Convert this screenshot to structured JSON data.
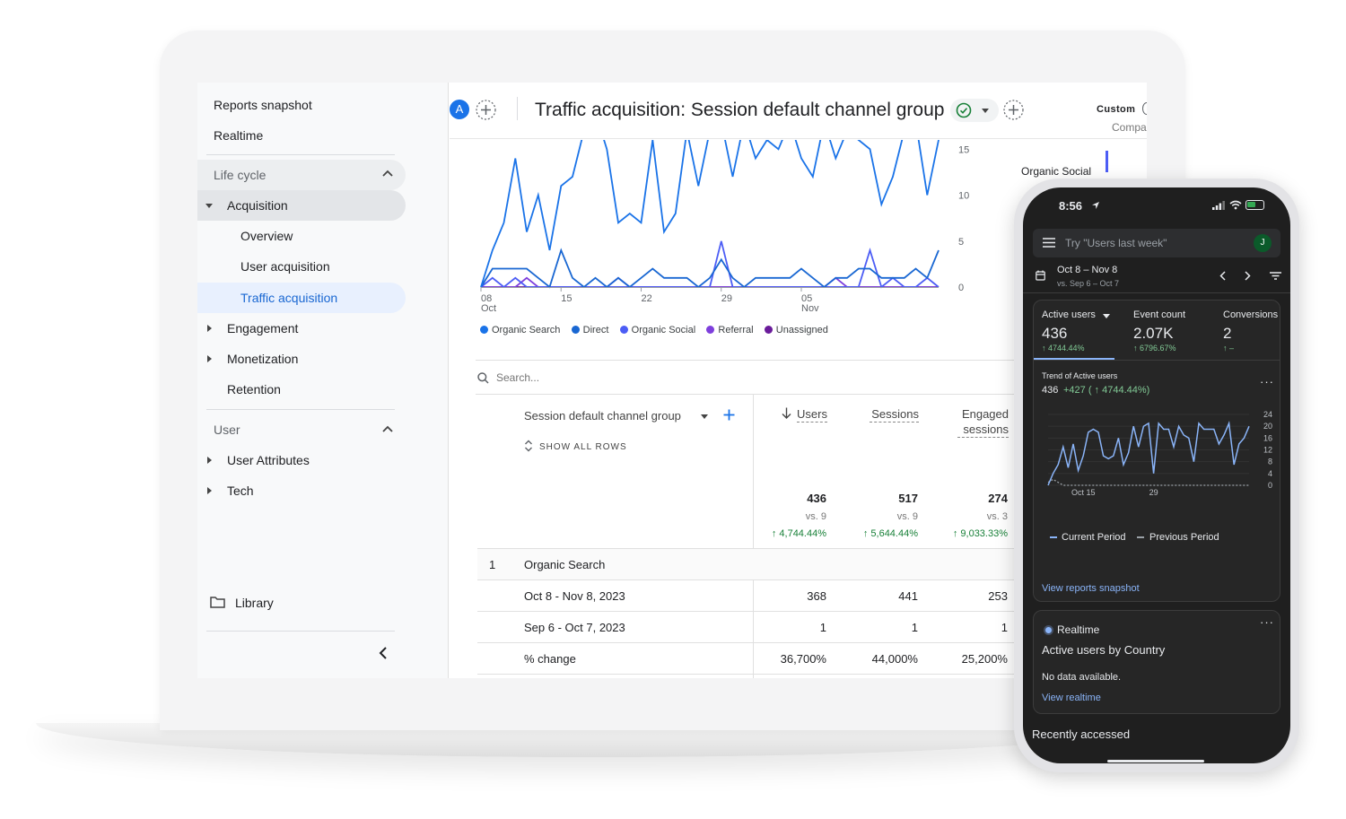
{
  "sidebar": {
    "top_items": [
      "Reports snapshot",
      "Realtime"
    ],
    "lifecycle": {
      "title": "Life cycle",
      "acquisition": {
        "label": "Acquisition",
        "children": [
          "Overview",
          "User acquisition",
          "Traffic acquisition"
        ]
      },
      "others": [
        "Engagement",
        "Monetization",
        "Retention"
      ]
    },
    "user": {
      "title": "User",
      "items": [
        "User Attributes",
        "Tech"
      ]
    },
    "library": "Library"
  },
  "header": {
    "avatar": "A",
    "title": "Traffic acquisition: Session default channel group",
    "custom": "Custom",
    "compare": "Compa"
  },
  "colors": {
    "organic_search": "#1a73e8",
    "direct": "#1967d2",
    "organic_social": "#4c5df5",
    "referral": "#7e3fdc",
    "unassigned": "#6a1b9a",
    "accent": "#1a73e8",
    "positive": "#188038"
  },
  "chart_data": {
    "type": "line",
    "x_tick_labels": [
      {
        "day": "08",
        "month": "Oct"
      },
      {
        "day": "15",
        "month": ""
      },
      {
        "day": "22",
        "month": ""
      },
      {
        "day": "29",
        "month": ""
      },
      {
        "day": "05",
        "month": "Nov"
      }
    ],
    "y_ticks": [
      0,
      5,
      10,
      15
    ],
    "ylim": [
      0,
      16
    ],
    "legend": [
      "Organic Search",
      "Direct",
      "Organic Social",
      "Referral",
      "Unassigned"
    ],
    "side_label": "Organic Social",
    "series": [
      {
        "name": "Organic Search",
        "values": [
          0,
          4,
          7,
          14,
          6,
          10,
          4,
          11,
          12,
          17,
          19,
          15,
          7,
          8,
          7,
          16,
          6,
          8,
          17,
          11,
          17,
          18,
          12,
          18,
          14,
          16,
          15,
          18,
          14,
          12,
          18,
          14,
          17,
          16,
          15,
          9,
          12,
          17,
          18,
          10,
          16
        ]
      },
      {
        "name": "Direct",
        "values": [
          0,
          2,
          2,
          2,
          2,
          1,
          0,
          4,
          1,
          0,
          1,
          0,
          1,
          0,
          1,
          2,
          1,
          1,
          1,
          0,
          1,
          3,
          1,
          0,
          1,
          1,
          1,
          1,
          2,
          1,
          0,
          1,
          1,
          2,
          2,
          1,
          1,
          1,
          2,
          1,
          4
        ]
      },
      {
        "name": "Organic Social",
        "values": [
          0,
          1,
          0,
          1,
          0,
          0,
          0,
          0,
          0,
          0,
          0,
          0,
          0,
          0,
          0,
          0,
          0,
          0,
          0,
          0,
          0,
          5,
          0,
          0,
          0,
          0,
          0,
          0,
          0,
          0,
          0,
          0,
          0,
          0,
          4,
          0,
          1,
          0,
          0,
          1,
          0
        ]
      },
      {
        "name": "Referral",
        "values": [
          0,
          0,
          0,
          0,
          1,
          0,
          0,
          0,
          0,
          0,
          0,
          0,
          1,
          0,
          0,
          0,
          0,
          0,
          0,
          0,
          0,
          0,
          0,
          0,
          0,
          0,
          0,
          0,
          0,
          0,
          0,
          1,
          0,
          0,
          0,
          0,
          0,
          0,
          0,
          0,
          0
        ]
      },
      {
        "name": "Unassigned",
        "values": [
          0,
          0,
          0,
          0,
          0,
          0,
          0,
          0,
          0,
          0,
          0,
          0,
          0,
          0,
          0,
          0,
          0,
          0,
          0,
          0,
          0,
          0,
          0,
          0,
          0,
          0,
          0,
          0,
          0,
          0,
          0,
          0,
          0,
          0,
          0,
          0,
          0,
          0,
          0,
          0,
          0
        ]
      }
    ]
  },
  "table": {
    "search_placeholder": "Search...",
    "dimension_label": "Session default channel group",
    "show_all_rows": "SHOW ALL ROWS",
    "columns": [
      "Users",
      "Sessions",
      "Engaged sessions"
    ],
    "totals": {
      "values": [
        "436",
        "517",
        "274"
      ],
      "vs": [
        "vs. 9",
        "vs. 9",
        "vs. 3"
      ],
      "change": [
        "↑ 4,744.44%",
        "↑ 5,644.44%",
        "↑ 9,033.33%"
      ]
    },
    "group": {
      "index": "1",
      "name": "Organic Search"
    },
    "rows": [
      {
        "label": "Oct 8 - Nov 8, 2023",
        "values": [
          "368",
          "441",
          "253"
        ]
      },
      {
        "label": "Sep 6 - Oct 7, 2023",
        "values": [
          "1",
          "1",
          "1"
        ]
      },
      {
        "label": "% change",
        "values": [
          "36,700%",
          "44,000%",
          "25,200%"
        ]
      }
    ]
  },
  "phone": {
    "time": "8:56",
    "search_placeholder": "Try \"Users last week\"",
    "avatar": "J",
    "date_range": "Oct 8 – Nov 8",
    "compare_range": "vs. Sep 6 – Oct 7",
    "metrics": [
      {
        "label": "Active users",
        "value": "436",
        "change": "↑ 4744.44%"
      },
      {
        "label": "Event count",
        "value": "2.07K",
        "change": "↑ 6796.67%"
      },
      {
        "label": "Conversions",
        "value": "2",
        "change": "↑ –"
      }
    ],
    "trend": {
      "title": "Trend of Active users",
      "value": "436",
      "delta": "+427 ( ↑ 4744.44%)"
    },
    "mini_chart": {
      "type": "line",
      "y_ticks": [
        0,
        4,
        8,
        12,
        16,
        20,
        24
      ],
      "ylim": [
        0,
        24
      ],
      "x_tick_labels": [
        "Oct 15",
        "29"
      ],
      "series": [
        {
          "name": "Current Period",
          "values": [
            0,
            4,
            7,
            13,
            6,
            14,
            5,
            10,
            18,
            19,
            18,
            10,
            9,
            10,
            16,
            7,
            11,
            20,
            13,
            20,
            21,
            4,
            21,
            19,
            19,
            13,
            20,
            17,
            16,
            8,
            21,
            19,
            19,
            19,
            14,
            17,
            21,
            7,
            14,
            16,
            20
          ]
        },
        {
          "name": "Previous Period",
          "values": [
            1,
            2,
            1,
            0,
            0,
            0,
            0,
            0,
            0,
            0,
            0,
            0,
            0,
            0,
            0,
            0,
            0,
            0,
            0,
            0,
            0,
            0,
            0,
            0,
            0,
            0,
            0,
            0,
            0,
            0,
            0,
            0,
            0,
            0,
            0,
            0,
            0,
            0,
            0,
            0,
            0
          ]
        }
      ]
    },
    "view_reports": "View reports snapshot",
    "realtime_title": "Realtime",
    "realtime_subtitle": "Active users by Country",
    "no_data": "No data available.",
    "view_realtime": "View realtime",
    "recently": "Recently accessed"
  }
}
